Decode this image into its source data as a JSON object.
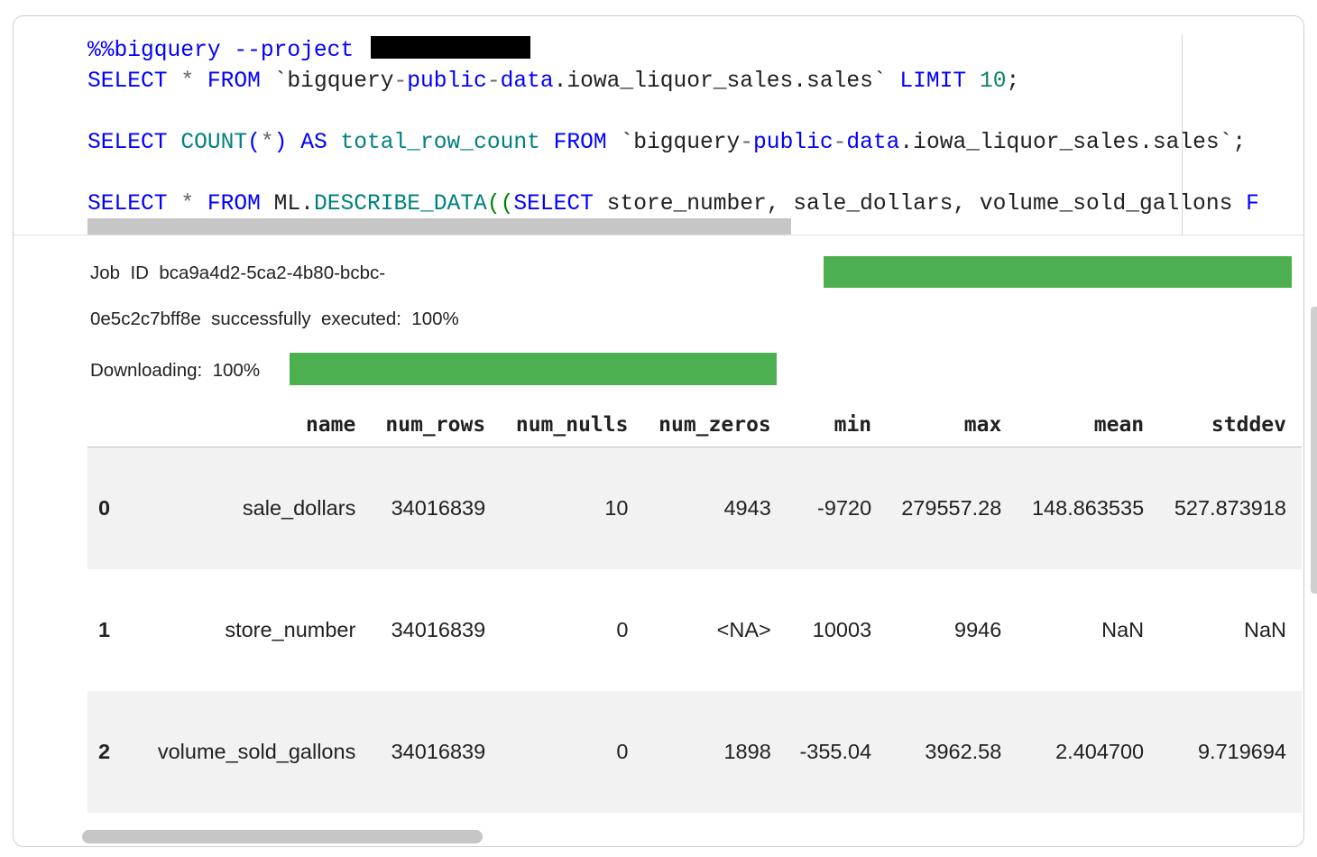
{
  "editor": {
    "lines": [
      [
        {
          "t": "%%bigquery --project ",
          "c": "k"
        },
        {
          "t": "",
          "c": "redact"
        }
      ],
      [
        {
          "t": "SELECT",
          "c": "k"
        },
        {
          "t": " "
        },
        {
          "t": "*",
          "c": "p"
        },
        {
          "t": " "
        },
        {
          "t": "FROM",
          "c": "k"
        },
        {
          "t": " `bigquery"
        },
        {
          "t": "-",
          "c": "p"
        },
        {
          "t": "public",
          "c": "k"
        },
        {
          "t": "-",
          "c": "p"
        },
        {
          "t": "data",
          "c": "k"
        },
        {
          "t": ".iowa_liquor_sales.sales` "
        },
        {
          "t": "LIMIT",
          "c": "k"
        },
        {
          "t": " "
        },
        {
          "t": "10",
          "c": "n"
        },
        {
          "t": ";"
        }
      ],
      [],
      [
        {
          "t": "SELECT",
          "c": "k"
        },
        {
          "t": " "
        },
        {
          "t": "COUNT",
          "c": "f"
        },
        {
          "t": "(",
          "c": "k"
        },
        {
          "t": "*",
          "c": "p"
        },
        {
          "t": ")",
          "c": "k"
        },
        {
          "t": " "
        },
        {
          "t": "AS",
          "c": "k"
        },
        {
          "t": " "
        },
        {
          "t": "total_row_count",
          "c": "f"
        },
        {
          "t": " "
        },
        {
          "t": "FROM",
          "c": "k"
        },
        {
          "t": " `bigquery"
        },
        {
          "t": "-",
          "c": "p"
        },
        {
          "t": "public",
          "c": "k"
        },
        {
          "t": "-",
          "c": "p"
        },
        {
          "t": "data",
          "c": "k"
        },
        {
          "t": ".iowa_liquor_sales.sales`;"
        }
      ],
      [],
      [
        {
          "t": "SELECT",
          "c": "k"
        },
        {
          "t": " "
        },
        {
          "t": "*",
          "c": "p"
        },
        {
          "t": " "
        },
        {
          "t": "FROM",
          "c": "k"
        },
        {
          "t": " ML."
        },
        {
          "t": "DESCRIBE_DATA",
          "c": "f"
        },
        {
          "t": "((",
          "c": "g"
        },
        {
          "t": "SELECT",
          "c": "k"
        },
        {
          "t": " store_number, sale_dollars, volume_sold_gallons "
        },
        {
          "t": "F",
          "c": "k"
        }
      ]
    ]
  },
  "output": {
    "job_line_1": "Job  ID  bca9a4d2-5ca2-4b80-bcbc-",
    "job_line_2": "0e5c2c7bff8e  successfully  executed:  100%",
    "job_progress": 1.0,
    "download_label": "Downloading:  100%",
    "download_progress": 1.0
  },
  "table": {
    "columns": [
      "name",
      "num_rows",
      "num_nulls",
      "num_zeros",
      "min",
      "max",
      "mean",
      "stddev"
    ],
    "rows": [
      {
        "index": "0",
        "values": [
          "sale_dollars",
          "34016839",
          "10",
          "4943",
          "-9720",
          "279557.28",
          "148.863535",
          "527.873918"
        ]
      },
      {
        "index": "1",
        "values": [
          "store_number",
          "34016839",
          "0",
          "<NA>",
          "10003",
          "9946",
          "NaN",
          "NaN"
        ]
      },
      {
        "index": "2",
        "values": [
          "volume_sold_gallons",
          "34016839",
          "0",
          "1898",
          "-355.04",
          "3962.58",
          "2.404700",
          "9.719694"
        ]
      }
    ]
  },
  "colors": {
    "progress_bar": "#4caf50",
    "keyword": "#0000ff",
    "function": "#008080",
    "number": "#098658"
  }
}
